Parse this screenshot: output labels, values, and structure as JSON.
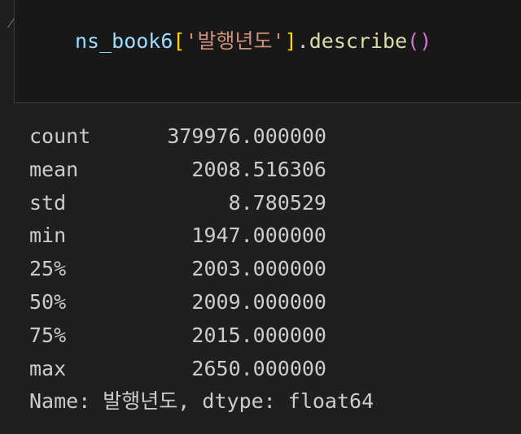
{
  "code_cell": {
    "variable": "ns_book6",
    "open_bracket": "[",
    "key_string": "'발행년도'",
    "close_bracket": "]",
    "dot": ".",
    "method": "describe",
    "parens": "()"
  },
  "output": {
    "rows": [
      {
        "label": "count",
        "value": "379976.000000"
      },
      {
        "label": "mean",
        "value": "2008.516306"
      },
      {
        "label": "std",
        "value": "8.780529"
      },
      {
        "label": "min",
        "value": "1947.000000"
      },
      {
        "label": "25%",
        "value": "2003.000000"
      },
      {
        "label": "50%",
        "value": "2009.000000"
      },
      {
        "label": "75%",
        "value": "2015.000000"
      },
      {
        "label": "max",
        "value": "2650.000000"
      }
    ],
    "footer": "Name: 발행년도, dtype: float64"
  }
}
